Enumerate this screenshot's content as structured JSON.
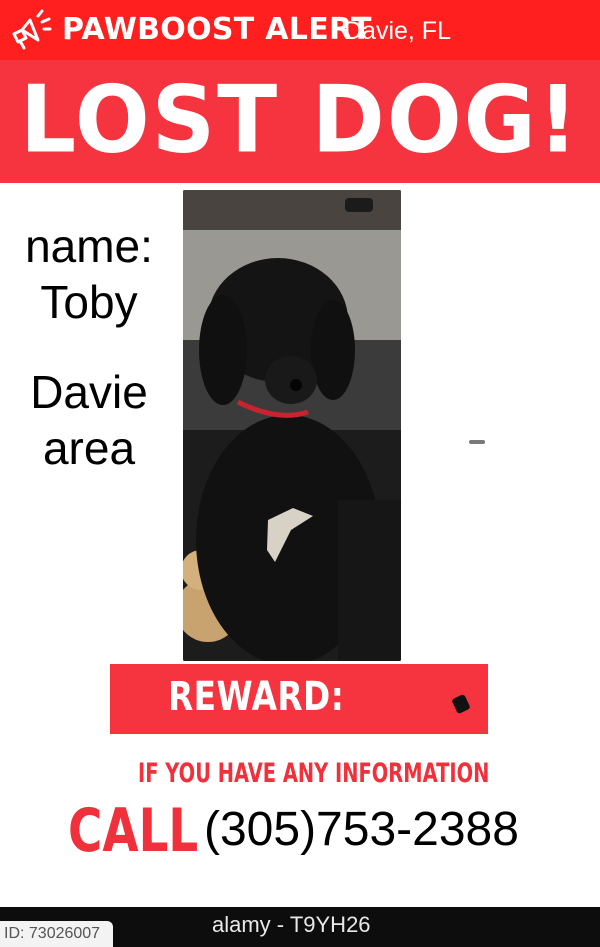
{
  "header": {
    "brand": "PAWBOOST ALERT",
    "location": "Davie, FL",
    "icon": "megaphone-icon"
  },
  "banner": {
    "title": "LOST DOG!"
  },
  "details": {
    "name_line1": "name:",
    "name_line2": "Toby",
    "area_line1": "Davie",
    "area_line2": "area"
  },
  "reward": {
    "label": "REWARD:"
  },
  "contact": {
    "info_line": "IF YOU HAVE ANY INFORMATION",
    "call_word": "CALL",
    "phone": "(305)753-2388"
  },
  "footer": {
    "watermark": "alamy - T9YH26",
    "id_label": "ID: 73026007"
  },
  "colors": {
    "header_red": "#ff1f1f",
    "banner_red": "#f5343f",
    "text_red": "#f0303b"
  }
}
